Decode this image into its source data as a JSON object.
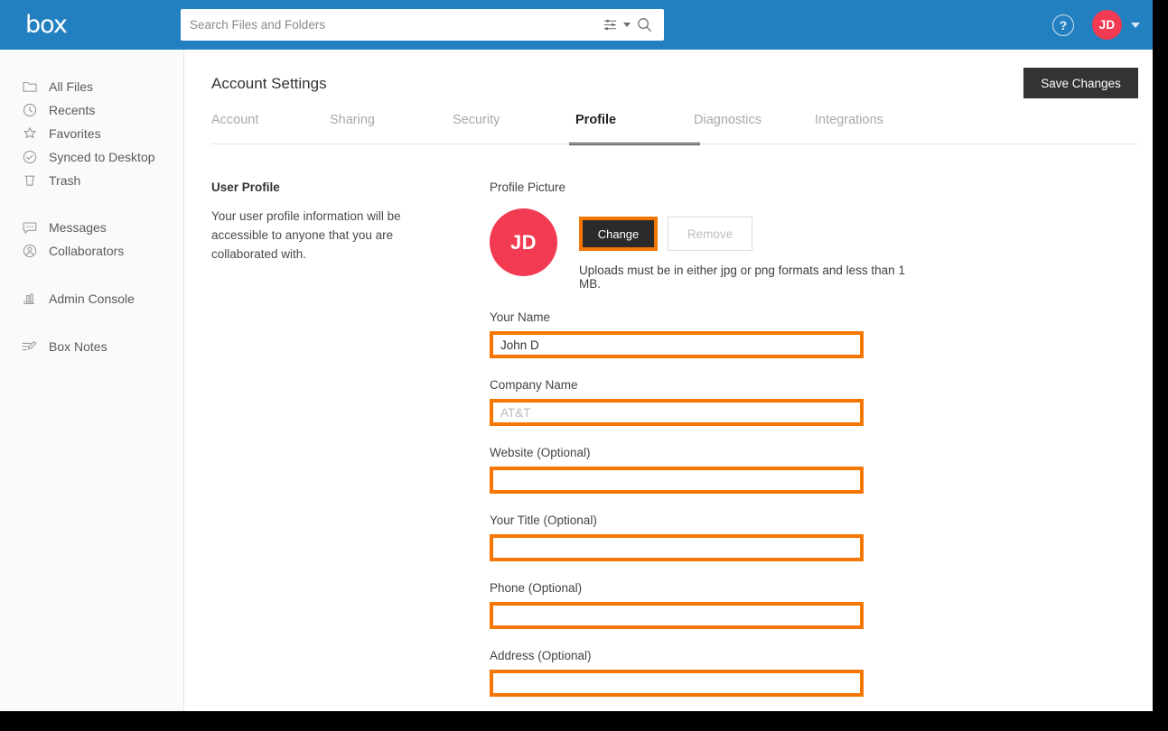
{
  "colors": {
    "topbar_blue": "#2380c0",
    "avatar_red": "#f23a52",
    "highlight_orange": "#f57600",
    "dark_button": "#333333"
  },
  "topbar": {
    "logo_text": "box",
    "search": {
      "placeholder": "Search Files and Folders",
      "value": "",
      "filter_icon": "sliders-icon",
      "chevron_icon": "chevron-down-icon",
      "search_icon": "search-icon"
    },
    "help_label": "?",
    "help_icon": "help-circle-icon",
    "avatar_initials": "JD",
    "avatar_chevron_icon": "chevron-down-icon"
  },
  "sidebar": {
    "groups": [
      {
        "items": [
          {
            "label": "All Files",
            "icon": "folder-icon"
          },
          {
            "label": "Recents",
            "icon": "clock-icon"
          },
          {
            "label": "Favorites",
            "icon": "star-icon"
          },
          {
            "label": "Synced to Desktop",
            "icon": "check-circle-icon"
          },
          {
            "label": "Trash",
            "icon": "trash-icon"
          }
        ]
      },
      {
        "items": [
          {
            "label": "Messages",
            "icon": "message-icon"
          },
          {
            "label": "Collaborators",
            "icon": "user-circle-icon"
          }
        ]
      },
      {
        "items": [
          {
            "label": "Admin Console",
            "icon": "bar-chart-icon"
          }
        ]
      },
      {
        "items": [
          {
            "label": "Box Notes",
            "icon": "notes-pencil-icon"
          }
        ]
      }
    ]
  },
  "main": {
    "page_title": "Account Settings",
    "save_label": "Save Changes",
    "tabs": [
      {
        "label": "Account",
        "active": false
      },
      {
        "label": "Sharing",
        "active": false
      },
      {
        "label": "Security",
        "active": false
      },
      {
        "label": "Profile",
        "active": true
      },
      {
        "label": "Diagnostics",
        "active": false
      },
      {
        "label": "Integrations",
        "active": false
      }
    ],
    "description": {
      "heading": "User Profile",
      "body": "Your user profile information will be accessible to anyone that you are collaborated with."
    },
    "profile_picture": {
      "label": "Profile Picture",
      "avatar_initials": "JD",
      "change_label": "Change",
      "remove_label": "Remove",
      "note": "Uploads must be in either jpg or png formats and less than 1 MB."
    },
    "fields": [
      {
        "label": "Your Name",
        "value": "John D",
        "placeholder": ""
      },
      {
        "label": "Company Name",
        "value": "",
        "placeholder": "AT&T"
      },
      {
        "label": "Website (Optional)",
        "value": "",
        "placeholder": ""
      },
      {
        "label": "Your Title (Optional)",
        "value": "",
        "placeholder": ""
      },
      {
        "label": "Phone (Optional)",
        "value": "",
        "placeholder": ""
      },
      {
        "label": "Address (Optional)",
        "value": "",
        "placeholder": ""
      }
    ]
  }
}
